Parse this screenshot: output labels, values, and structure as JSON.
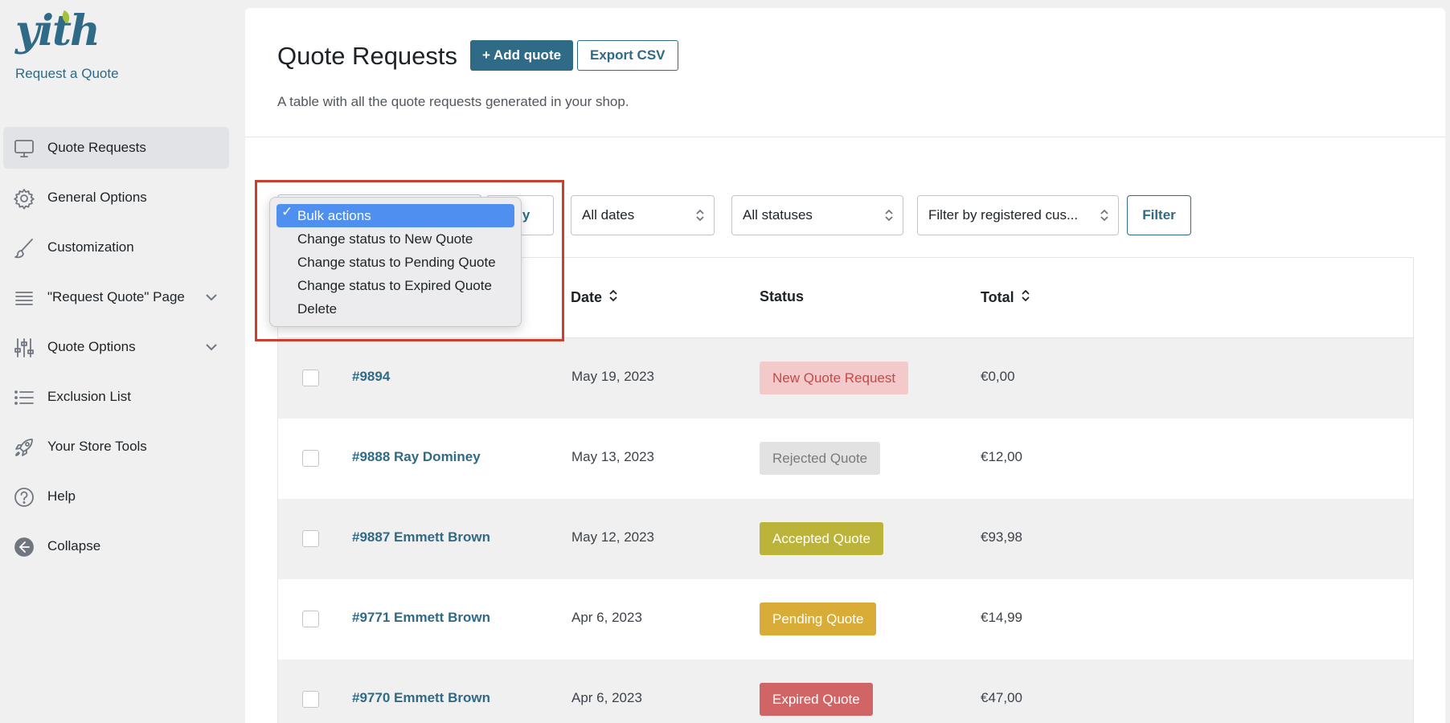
{
  "brand": {
    "logo_text": "yith",
    "plugin_name": "Request a Quote"
  },
  "sidebar": {
    "items": [
      {
        "label": "Quote Requests",
        "icon": "monitor-icon",
        "active": true
      },
      {
        "label": "General Options",
        "icon": "gear-icon"
      },
      {
        "label": "Customization",
        "icon": "brush-icon"
      },
      {
        "label": "\"Request Quote\" Page",
        "icon": "layers-icon",
        "expandable": true
      },
      {
        "label": "Quote Options",
        "icon": "sliders-icon",
        "expandable": true
      },
      {
        "label": "Exclusion List",
        "icon": "list-icon"
      },
      {
        "label": "Your Store Tools",
        "icon": "rocket-icon"
      },
      {
        "label": "Help",
        "icon": "help-icon"
      },
      {
        "label": "Collapse",
        "icon": "collapse-icon"
      }
    ]
  },
  "header": {
    "title": "Quote Requests",
    "add_label": "+ Add quote",
    "export_label": "Export CSV",
    "description": "A table with all the quote requests generated in your shop."
  },
  "filters": {
    "apply_label": "Apply",
    "apply_visible_text": "ply",
    "dates": "All dates",
    "statuses": "All statuses",
    "customer": "Filter by registered cus...",
    "filter_label": "Filter"
  },
  "bulk_dropdown": {
    "options": [
      {
        "label": "Bulk actions",
        "selected": true
      },
      {
        "label": "Change status to New Quote"
      },
      {
        "label": "Change status to Pending Quote"
      },
      {
        "label": "Change status to Expired Quote"
      },
      {
        "label": "Delete"
      }
    ],
    "check": "✓"
  },
  "table": {
    "columns": {
      "date": "Date",
      "status": "Status",
      "total": "Total"
    },
    "rows": [
      {
        "order": "#9894",
        "date": "May 19, 2023",
        "status": "New Quote Request",
        "status_bg": "#f3c9c9",
        "status_color": "#c24a4a",
        "total": "€0,00"
      },
      {
        "order": "#9888 Ray Dominey",
        "date": "May 13, 2023",
        "status": "Rejected Quote",
        "status_bg": "#e2e2e2",
        "status_color": "#7a7a7a",
        "total": "€12,00"
      },
      {
        "order": "#9887 Emmett Brown",
        "date": "May 12, 2023",
        "status": "Accepted Quote",
        "status_bg": "#bcb43a",
        "status_color": "#ffffff",
        "total": "€93,98"
      },
      {
        "order": "#9771 Emmett Brown",
        "date": "Apr 6, 2023",
        "status": "Pending Quote",
        "status_bg": "#d9ac38",
        "status_color": "#ffffff",
        "total": "€14,99"
      },
      {
        "order": "#9770 Emmett Brown",
        "date": "Apr 6, 2023",
        "status": "Expired Quote",
        "status_bg": "#d16565",
        "status_color": "#ffffff",
        "total": "€47,00"
      }
    ]
  },
  "colors": {
    "accent": "#2f6a86",
    "highlight": "#c9402e",
    "selection": "#4f8ff0"
  }
}
